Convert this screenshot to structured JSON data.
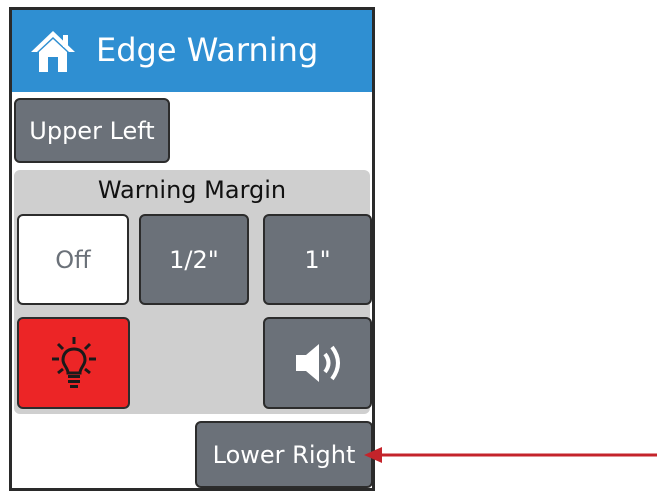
{
  "header": {
    "title": "Edge Warning",
    "icon": "home-icon",
    "background": "#2f8fd2"
  },
  "upper_left_button": {
    "label": "Upper Left"
  },
  "warning_margin": {
    "title": "Warning Margin",
    "options": [
      {
        "label": "Off",
        "selected": true
      },
      {
        "label": "1/2\"",
        "selected": false
      },
      {
        "label": "1\"",
        "selected": false
      }
    ]
  },
  "light_toggle": {
    "icon": "lightbulb-icon",
    "active": true,
    "color": "#ec2526"
  },
  "sound_toggle": {
    "icon": "speaker-icon",
    "active": false
  },
  "lower_right_button": {
    "label": "Lower Right"
  },
  "callout_arrow": {
    "color": "#c4242b",
    "points_to": "lower-right-button"
  }
}
